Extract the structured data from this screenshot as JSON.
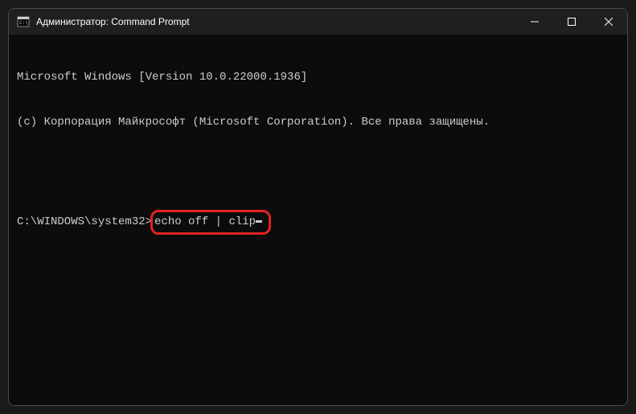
{
  "titlebar": {
    "title": "Администратор: Command Prompt"
  },
  "terminal": {
    "line1": "Microsoft Windows [Version 10.0.22000.1936]",
    "line2": "(c) Корпорация Майкрософт (Microsoft Corporation). Все права защищены.",
    "prompt": "C:\\WINDOWS\\system32>",
    "command": "echo off | clip"
  }
}
